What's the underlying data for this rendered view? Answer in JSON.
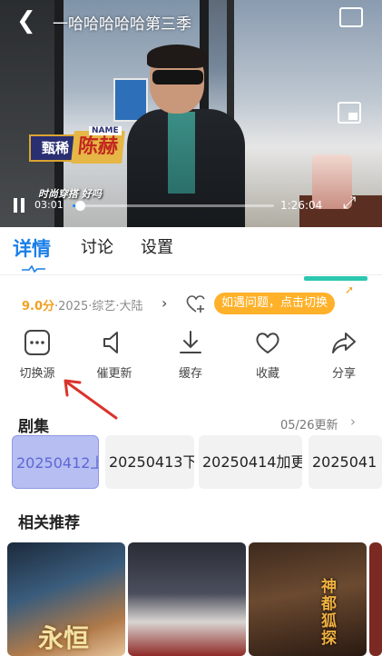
{
  "player": {
    "back_icon": "back-arrow-icon",
    "title": "一哈哈哈哈哈第三季",
    "subtitle": "时尚穿搭 好吗",
    "brand_logo": "甄稀",
    "name_card": "陈赫",
    "name_card_tag": "NAME",
    "time_current": "03:01",
    "time_total": "1:26:04",
    "progress": 0.035,
    "progress_color": "#1e87ff"
  },
  "tabs": [
    {
      "label": "详情",
      "active": true
    },
    {
      "label": "讨论",
      "active": false
    },
    {
      "label": "设置",
      "active": false
    }
  ],
  "meta": {
    "score": "9.0分",
    "info": "·2025·综艺·大陆",
    "switch_hint": "如遇问题，点击切换"
  },
  "actions": [
    {
      "label": "切换源",
      "icon": "switch-source-icon"
    },
    {
      "label": "催更新",
      "icon": "speaker-icon"
    },
    {
      "label": "缓存",
      "icon": "download-icon"
    },
    {
      "label": "收藏",
      "icon": "heart-icon"
    },
    {
      "label": "分享",
      "icon": "share-icon"
    }
  ],
  "episodes": {
    "title": "剧集",
    "update": "05/26更新",
    "items": [
      "20250412上",
      "20250413下",
      "20250414加更",
      "2025041"
    ],
    "selected_index": 0
  },
  "recommendations": {
    "title": "相关推荐",
    "items": [
      {
        "title": "永恒"
      },
      {
        "title": ""
      },
      {
        "title": "神都狐探"
      }
    ]
  },
  "colors": {
    "accent": "#1a7fe8",
    "score": "#f0a020",
    "hint": "#ffb129",
    "selected_episode": "#b6bef2"
  }
}
